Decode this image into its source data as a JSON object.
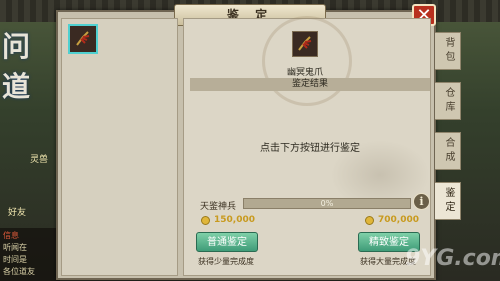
{
  "window": {
    "title": "鉴 定",
    "close_label": "✕"
  },
  "game_logo": "问道",
  "item": {
    "name": "幽冥鬼爪",
    "icon": "claw-icon"
  },
  "result": {
    "header": "鉴定结果",
    "hint": "点击下方按钮进行鉴定"
  },
  "progress": {
    "label": "天鉴神兵",
    "percent_text": "0%",
    "value": 0
  },
  "info_label": "i",
  "normal": {
    "cost": "150,000",
    "button_label": "普通鉴定",
    "desc": "获得少量完成度"
  },
  "precise": {
    "cost": "700,000",
    "button_label": "精致鉴定",
    "desc": "获得大量完成度"
  },
  "tabs": [
    {
      "label": "背包",
      "active": false
    },
    {
      "label": "仓库",
      "active": false
    },
    {
      "label": "合成",
      "active": false
    },
    {
      "label": "鉴定",
      "active": true
    }
  ],
  "chat": {
    "lines": [
      "信息",
      "听闻在",
      "时间是",
      "各位道友"
    ]
  },
  "side_text": {
    "level": "灵兽",
    "friend": "好友"
  },
  "watermark": "9YG.com",
  "colors": {
    "accent_green": "#3f9c78",
    "close_red": "#b8301e",
    "gold": "#c89a1e"
  }
}
